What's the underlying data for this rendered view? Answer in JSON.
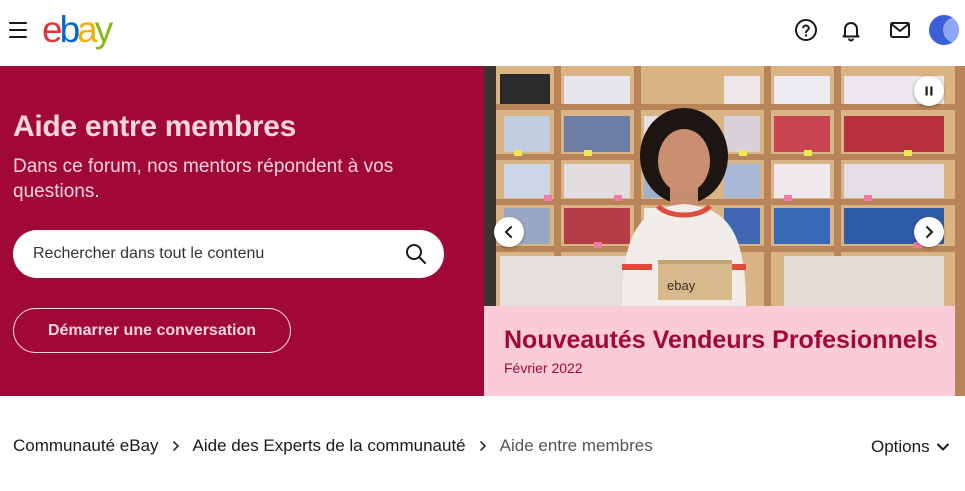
{
  "header": {
    "logo_letters": [
      {
        "char": "e",
        "color": "#e53238"
      },
      {
        "char": "b",
        "color": "#0064d2"
      },
      {
        "char": "a",
        "color": "#f5af02"
      },
      {
        "char": "y",
        "color": "#86b817"
      }
    ],
    "icons": [
      "menu-icon",
      "help-icon",
      "bell-icon",
      "mail-icon"
    ]
  },
  "hero": {
    "title": "Aide entre membres",
    "subtitle": "Dans ce forum, nos mentors répondent à vos questions.",
    "search_placeholder": "Rechercher dans tout le contenu",
    "cta_label": "Démarrer une conversation",
    "accent_color": "#a00838",
    "text_color": "#fcd5e0"
  },
  "carousel": {
    "slide_title": "Nouveautés Vendeurs Profesionnels",
    "slide_date": "Février 2022",
    "box_label": "ebay",
    "caption_bg": "#fccbd8"
  },
  "breadcrumb": {
    "items": [
      "Communauté eBay",
      "Aide des Experts de la communauté"
    ],
    "current": "Aide entre membres"
  },
  "options_label": "Options"
}
